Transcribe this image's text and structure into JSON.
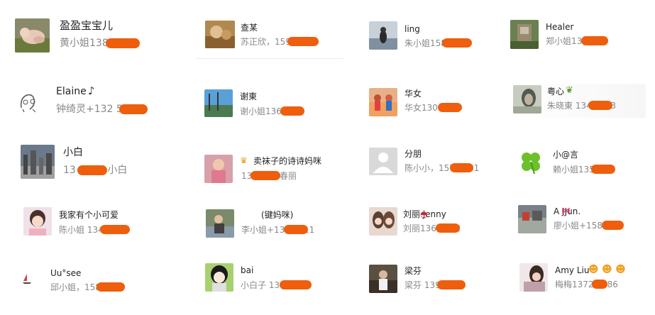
{
  "contacts": [
    {
      "name": "盈盈宝宝儿",
      "sub": "黄小姐138 278"
    },
    {
      "name": "查某",
      "sub": "苏正欣，159 66"
    },
    {
      "name": "ling",
      "sub": "朱小姐158 43"
    },
    {
      "name": "Healer",
      "sub": "郑小姐137 400"
    },
    {
      "name": "Elaine",
      "sub": "钟绮灵+132 58"
    },
    {
      "name": "谢東",
      "sub": "谢小姐136 127"
    },
    {
      "name": "华女",
      "sub": "华女130 451"
    },
    {
      "name": "粤心",
      "sub": "朱晓東 134 1363"
    },
    {
      "name": "小白",
      "sub": "13 6266 小白"
    },
    {
      "name": "卖袜子的诗诗妈咪",
      "sub": "13 821潘春丽"
    },
    {
      "name": "分朋",
      "sub": "陈小小，157 6881"
    },
    {
      "name": "小@言",
      "sub": "赖小姐135 067"
    },
    {
      "name": "我家有个小可爱",
      "sub": "陈小姐 134 89"
    },
    {
      "name": "(键妈咪)",
      "sub": "李小姐+134 5811"
    },
    {
      "name": "刘丽 jenny",
      "sub": "刘丽136 0462"
    },
    {
      "name": "A JJun.",
      "sub": "廖小姐+158 622"
    },
    {
      "name": "Uu°see",
      "sub": "邱小姐，158 24"
    },
    {
      "name": "bai",
      "sub": "小白子 13 21"
    },
    {
      "name": "梁芬",
      "sub": "梁芬 139 32"
    },
    {
      "name": "Amy Liu",
      "sub": "梅梅1372 6686"
    }
  ],
  "colors": {
    "redaction": "#ee5e0c",
    "name_text": "#222222",
    "sub_text": "#888888"
  },
  "icons": {
    "clover": "four-leaf-clover-icon",
    "default_avatar": "default-user-icon",
    "sailboat": "sailboat-icon",
    "crown": "crown-emoji-icon",
    "lips": "lips-emoji-icon",
    "bow": "bow-emoji-icon",
    "leaf": "leaf-emoji-icon",
    "music": "music-note-icon",
    "kiss": "kiss-emoji-icon"
  }
}
